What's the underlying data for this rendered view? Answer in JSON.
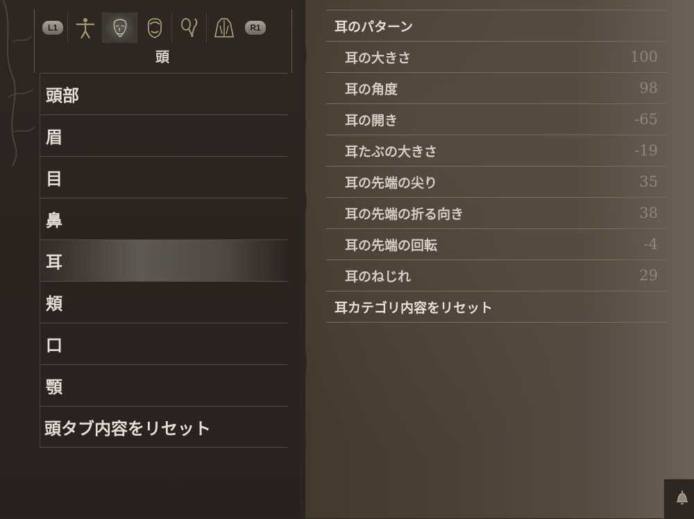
{
  "tabs": {
    "left_bumper": "L1",
    "right_bumper": "R1",
    "icons": [
      "body-icon",
      "face-icon",
      "hair-icon",
      "tools-icon",
      "torso-icon"
    ],
    "active_index": 1,
    "title": "頭"
  },
  "categories": {
    "items": [
      "頭部",
      "眉",
      "目",
      "鼻",
      "耳",
      "頬",
      "口",
      "顎"
    ],
    "selected_index": 4,
    "reset_label": "頭タブ内容をリセット"
  },
  "detail": {
    "header": "耳のパターン",
    "params": [
      {
        "label": "耳の大きさ",
        "value": "100"
      },
      {
        "label": "耳の角度",
        "value": "98"
      },
      {
        "label": "耳の開き",
        "value": "-65"
      },
      {
        "label": "耳たぶの大きさ",
        "value": "-19"
      },
      {
        "label": "耳の先端の尖り",
        "value": "35"
      },
      {
        "label": "耳の先端の折る向き",
        "value": "38"
      },
      {
        "label": "耳の先端の回転",
        "value": "-4"
      },
      {
        "label": "耳のねじれ",
        "value": "29"
      }
    ],
    "reset_label": "耳カテゴリ内容をリセット"
  },
  "colors": {
    "left_panel": "#2b2522",
    "right_panel": "#4b4137",
    "text": "#e3ddd4",
    "value_text": "#8e857b",
    "divider": "#594a3f"
  }
}
